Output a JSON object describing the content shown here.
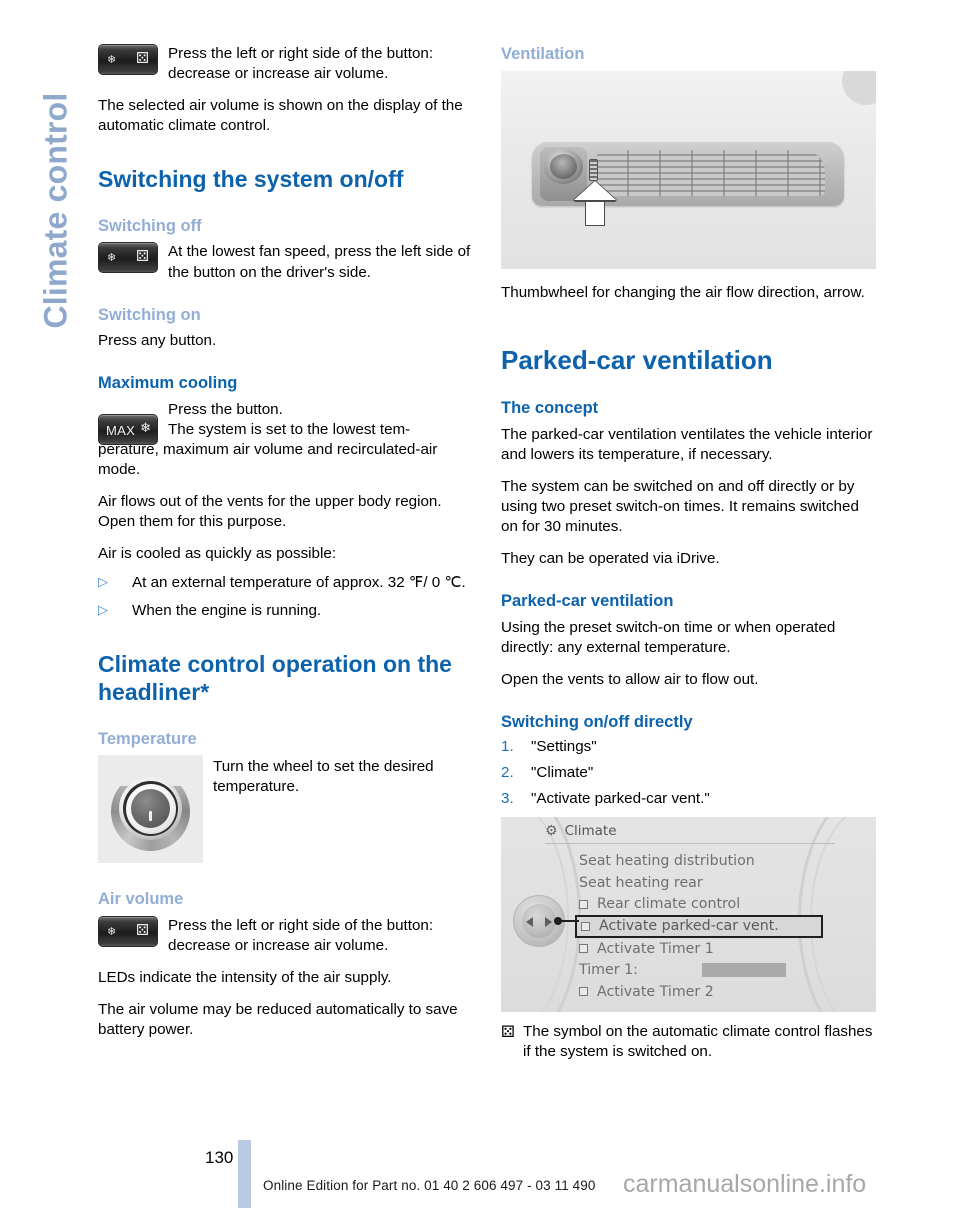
{
  "sidebar": {
    "chapter_label": "Climate control"
  },
  "left_column": {
    "fan_button_note": {
      "icon": "fan-rocker-button",
      "text": "Press the left or right side of the button: decrease or increase air volume."
    },
    "intro_paragraph": "The selected air volume is shown on the display of the automatic climate control.",
    "heading_switching_system": "Switching the system on/off",
    "heading_switching_off": "Switching off",
    "switching_off_note": {
      "icon": "fan-rocker-button",
      "text": "At the lowest fan speed, press the left side of the button on the driver's side."
    },
    "heading_switching_on": "Switching on",
    "switching_on_text": "Press any button.",
    "heading_maximum_cooling": "Maximum cooling",
    "max_button_label": "MAX",
    "max_button_icon": "snowflake-icon",
    "max_line_1": "Press the button.",
    "max_line_2": "The system is set to the lowest tem-",
    "max_line_3": "perature, maximum air volume and recirculated-air mode.",
    "max_paragraph_2": "Air flows out of the vents for the upper body region. Open them for this purpose.",
    "max_paragraph_3": "Air is cooled as quickly as possible:",
    "bullets": [
      "At an external temperature of approx. 32 ℉/ 0 ℃.",
      "When the engine is running."
    ],
    "heading_headliner": "Climate control operation on the headliner*",
    "heading_temperature": "Temperature",
    "temperature_note": {
      "figure": "rotary-temperature-knob",
      "text": "Turn the wheel to set the desired temperature."
    },
    "heading_air_volume": "Air volume",
    "air_volume_note": {
      "icon": "fan-rocker-button",
      "text": "Press the left or right side of the button: decrease or increase air volume."
    },
    "air_volume_paragraph_1": "LEDs indicate the intensity of the air supply.",
    "air_volume_paragraph_2": "The air volume may be reduced automatically to save battery power."
  },
  "right_column": {
    "heading_ventilation": "Ventilation",
    "ventilation_figure": "vent-with-thumbwheel-and-arrow",
    "ventilation_caption": "Thumbwheel for changing the air flow direction, arrow.",
    "heading_parked_car_ventilation_main": "Parked-car ventilation",
    "heading_the_concept": "The concept",
    "concept_paragraph_1": "The parked-car ventilation ventilates the vehicle interior and lowers its temperature, if necessary.",
    "concept_paragraph_2": "The system can be switched on and off directly or by using two preset switch-on times. It remains switched on for 30 minutes.",
    "concept_paragraph_3": "They can be operated via iDrive.",
    "heading_parked_car_ventilation_sub": "Parked-car ventilation",
    "parked_paragraph_1": "Using the preset switch-on time or when operated directly: any external temperature.",
    "parked_paragraph_2": "Open the vents to allow air to flow out.",
    "heading_switching_directly": "Switching on/off directly",
    "steps": [
      {
        "num": "1.",
        "text": "\"Settings\""
      },
      {
        "num": "2.",
        "text": "\"Climate\""
      },
      {
        "num": "3.",
        "text": "\"Activate parked-car vent.\""
      }
    ],
    "idrive": {
      "header_icon": "gear-icon",
      "header_title": "Climate",
      "items": [
        {
          "label": "Seat heating distribution",
          "checkbox": false,
          "selected": false
        },
        {
          "label": "Seat heating rear",
          "checkbox": false,
          "selected": false
        },
        {
          "label": "Rear climate control",
          "checkbox": true,
          "selected": false
        },
        {
          "label": "Activate parked-car vent.",
          "checkbox": true,
          "selected": true
        },
        {
          "label": "Activate Timer 1",
          "checkbox": true,
          "selected": false
        },
        {
          "label": "Timer 1:",
          "checkbox": false,
          "selected": false,
          "value_box": true
        },
        {
          "label": "Activate Timer 2",
          "checkbox": true,
          "selected": false
        }
      ]
    },
    "note": {
      "glyph": "fan-symbol",
      "text": "The symbol on the automatic climate control flashes if the system is switched on."
    }
  },
  "footer": {
    "page_number": "130",
    "edition_line": "Online Edition for Part no. 01 40 2 606 497 - 03 11 490",
    "watermark": "carmanualsonline.info"
  },
  "colors": {
    "heading_blue": "#0d62ac",
    "subheading_light_blue": "#92aed6",
    "sidebar_blue": "#8fa9cd",
    "tab_marker": "#b8c9e3"
  }
}
